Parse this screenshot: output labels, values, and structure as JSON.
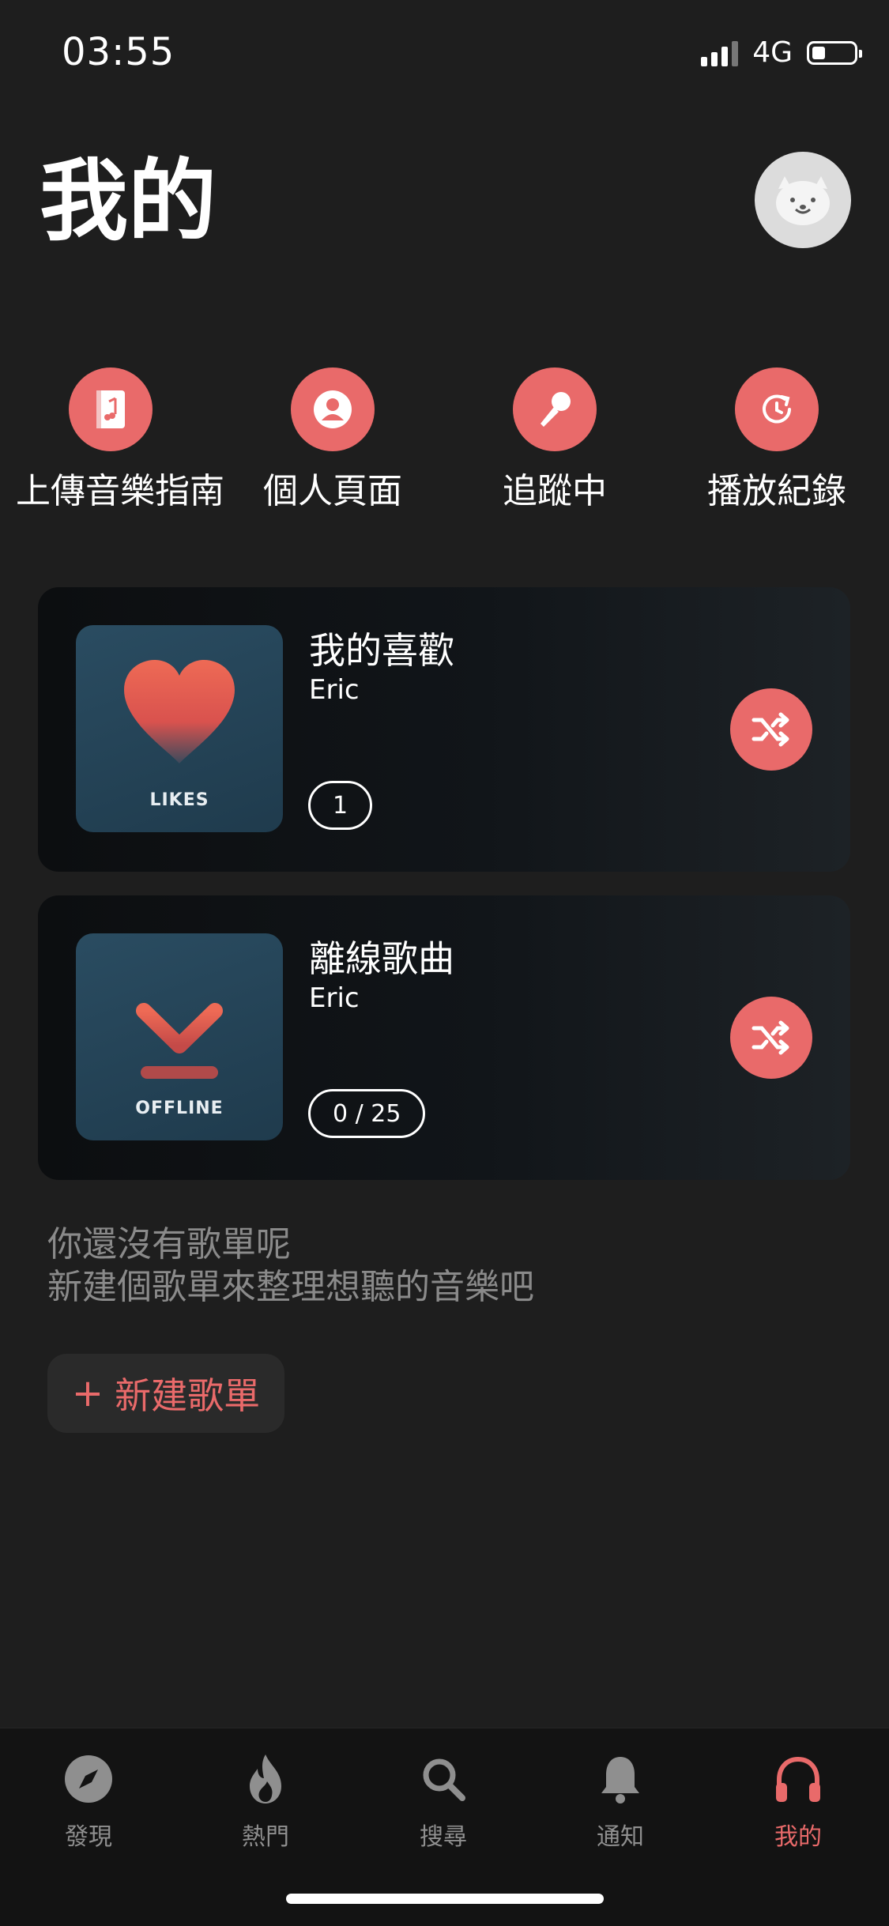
{
  "status_bar": {
    "time": "03:55",
    "network": "4G",
    "battery_level": 0.3,
    "signal_bars": 4
  },
  "header": {
    "title": "我的"
  },
  "quick_actions": [
    {
      "label": "上傳音樂指南",
      "icon": "music-book-icon"
    },
    {
      "label": "個人頁面",
      "icon": "person-icon"
    },
    {
      "label": "追蹤中",
      "icon": "microphone-icon"
    },
    {
      "label": "播放紀錄",
      "icon": "history-icon"
    }
  ],
  "playlists": [
    {
      "title": "我的喜歡",
      "owner": "Eric",
      "cover_label": "LIKES",
      "cover_icon": "heart-icon",
      "count": "1"
    },
    {
      "title": "離線歌曲",
      "owner": "Eric",
      "cover_label": "OFFLINE",
      "cover_icon": "download-icon",
      "count": "0 / 25"
    }
  ],
  "empty_state": {
    "line1": "你還沒有歌單呢",
    "line2": "新建個歌單來整理想聽的音樂吧"
  },
  "new_playlist": {
    "plus": "+",
    "label": "新建歌單"
  },
  "tabs": [
    {
      "label": "發現",
      "icon": "compass-icon"
    },
    {
      "label": "熱門",
      "icon": "flame-icon"
    },
    {
      "label": "搜尋",
      "icon": "search-icon"
    },
    {
      "label": "通知",
      "icon": "bell-icon"
    },
    {
      "label": "我的",
      "icon": "headphones-icon",
      "active": true
    }
  ],
  "colors": {
    "accent": "#e96a6a",
    "background": "#1e1e1e",
    "tabbar": "#131313"
  }
}
